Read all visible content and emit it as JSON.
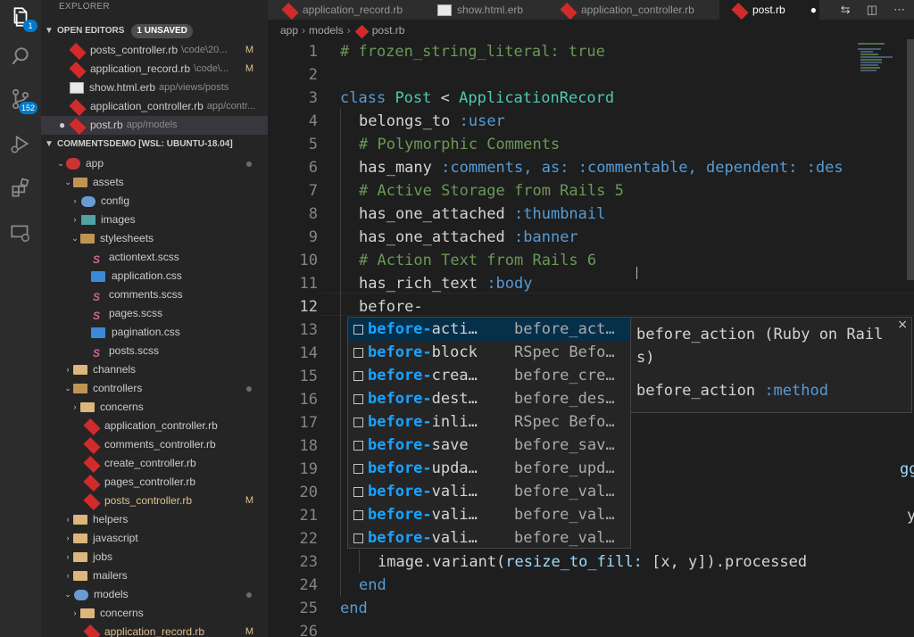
{
  "activity": {
    "explorer_badge": "1",
    "scm_badge": "152"
  },
  "sidebar": {
    "title": "EXPLORER",
    "open_editors": {
      "label": "OPEN EDITORS",
      "unsaved": "1 UNSAVED",
      "items": [
        {
          "name": "posts_controller.rb",
          "path": "\\code\\20...",
          "mark": "M"
        },
        {
          "name": "application_record.rb",
          "path": "\\code\\...",
          "mark": "M"
        },
        {
          "name": "show.html.erb",
          "path": "app/views/posts",
          "mark": ""
        },
        {
          "name": "application_controller.rb",
          "path": "app/contr...",
          "mark": ""
        },
        {
          "name": "post.rb",
          "path": "app/models",
          "mark": ""
        }
      ]
    },
    "workspace": {
      "label": "COMMENTSDEMO [WSL: UBUNTU-18.04]",
      "tree": [
        "app",
        "assets",
        "config",
        "images",
        "stylesheets",
        "actiontext.scss",
        "application.css",
        "comments.scss",
        "pages.scss",
        "pagination.css",
        "posts.scss",
        "channels",
        "controllers",
        "concerns",
        "application_controller.rb",
        "comments_controller.rb",
        "create_controller.rb",
        "pages_controller.rb",
        "posts_controller.rb",
        "helpers",
        "javascript",
        "jobs",
        "mailers",
        "models",
        "concerns",
        "application_record.rb"
      ],
      "posts_controller_mark": "M",
      "application_record_mark": "M"
    }
  },
  "tabs": [
    "application_record.rb",
    "show.html.erb",
    "application_controller.rb",
    "post.rb"
  ],
  "breadcrumb": [
    "app",
    "models",
    "post.rb"
  ],
  "editor": {
    "line_numbers": [
      "1",
      "2",
      "3",
      "4",
      "5",
      "6",
      "7",
      "8",
      "9",
      "10",
      "11",
      "12",
      "13",
      "14",
      "15",
      "16",
      "17",
      "18",
      "19",
      "20",
      "21",
      "22",
      "23",
      "24",
      "25",
      "26"
    ],
    "lines": {
      "l1": "# frozen_string_literal: true",
      "l3a": "class",
      "l3b": "Post",
      "l3c": "<",
      "l3d": "ApplicationRecord",
      "l4a": "belongs_to",
      "l4b": ":user",
      "l5": "# Polymorphic Comments",
      "l6a": "has_many",
      "l6b": ":comments,",
      "l6c": "as:",
      "l6d": ":commentable,",
      "l6e": "dependent:",
      "l6f": ":des",
      "l7": "# Active Storage from Rails 5",
      "l8a": "has_one_attached",
      "l8b": ":thumbnail",
      "l9a": "has_one_attached",
      "l9b": ":banner",
      "l10": "# Action Text from Rails 6",
      "l11a": "has_rich_text",
      "l11b": ":body",
      "l12": "before-",
      "l19": "gged",
      "l21": "y)",
      "l23a": "image.variant(",
      "l23b": "resize_to_fill:",
      "l23c": "[x, y]).processed",
      "l24": "end",
      "l25": "end"
    }
  },
  "suggest": {
    "items": [
      {
        "match": "before-",
        "rest": "acti…",
        "detail": "before_act…"
      },
      {
        "match": "before-",
        "rest": "block",
        "detail": "RSpec Befo…"
      },
      {
        "match": "before-",
        "rest": "crea…",
        "detail": "before_cre…"
      },
      {
        "match": "before-",
        "rest": "dest…",
        "detail": "before_des…"
      },
      {
        "match": "before-",
        "rest": "inli…",
        "detail": "RSpec Befo…"
      },
      {
        "match": "before-",
        "rest": "save",
        "detail": "before_sav…"
      },
      {
        "match": "before-",
        "rest": "upda…",
        "detail": "before_upd…"
      },
      {
        "match": "before-",
        "rest": "vali…",
        "detail": "before_val…"
      },
      {
        "match": "before-",
        "rest": "vali…",
        "detail": "before_val…"
      },
      {
        "match": "before-",
        "rest": "vali…",
        "detail": "before_val…"
      }
    ],
    "detail_title": "before_action (Ruby on Rails)",
    "detail_body_a": "before_action",
    "detail_body_b": ":method",
    "close": "×"
  }
}
